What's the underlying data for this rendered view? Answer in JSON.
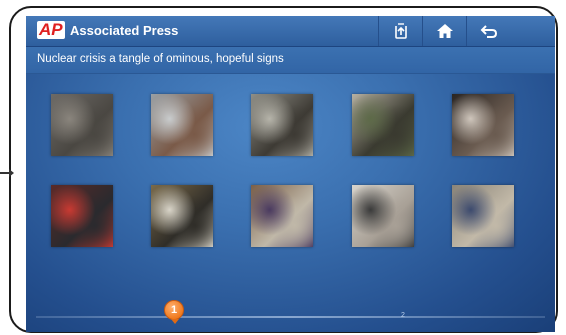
{
  "header": {
    "logo_text": "AP",
    "title": "Associated Press",
    "buttons": [
      {
        "name": "share-button",
        "icon": "share-icon"
      },
      {
        "name": "home-button",
        "icon": "home-icon"
      },
      {
        "name": "back-button",
        "icon": "back-arrow-icon"
      }
    ]
  },
  "story": {
    "title": "Nuclear crisis a tangle of ominous, hopeful signs"
  },
  "gallery": {
    "rows": [
      [
        {
          "subject": "rubble-scene",
          "colors": [
            "#6d6a66",
            "#8a857d",
            "#4a4742"
          ]
        },
        {
          "subject": "person-in-snow",
          "colors": [
            "#9aa0a4",
            "#c9cccd",
            "#7a5a48"
          ]
        },
        {
          "subject": "damaged-building",
          "colors": [
            "#8f8e86",
            "#b6b4aa",
            "#3d3a34"
          ]
        },
        {
          "subject": "soldiers-map",
          "colors": [
            "#b7b1a3",
            "#5d6a48",
            "#3a3a30"
          ]
        },
        {
          "subject": "woman-with-mask",
          "colors": [
            "#2a2522",
            "#cfc6bc",
            "#6a5b50"
          ]
        }
      ],
      [
        {
          "subject": "crowd-red-coats",
          "colors": [
            "#5a2a28",
            "#c83a32",
            "#2a2a2e"
          ]
        },
        {
          "subject": "hazmat-check",
          "colors": [
            "#7a6a4a",
            "#d8d4c8",
            "#2f2d28"
          ]
        },
        {
          "subject": "evacuation-center",
          "colors": [
            "#7a5f48",
            "#4a3a60",
            "#c0b8a8"
          ]
        },
        {
          "subject": "men-with-papers",
          "colors": [
            "#d8d4cc",
            "#3a3a3a",
            "#a8a096"
          ]
        },
        {
          "subject": "searching-debris",
          "colors": [
            "#8a8478",
            "#3c4a6e",
            "#c2b9a8"
          ]
        }
      ]
    ]
  },
  "pager": {
    "current": "1",
    "next": "2"
  }
}
